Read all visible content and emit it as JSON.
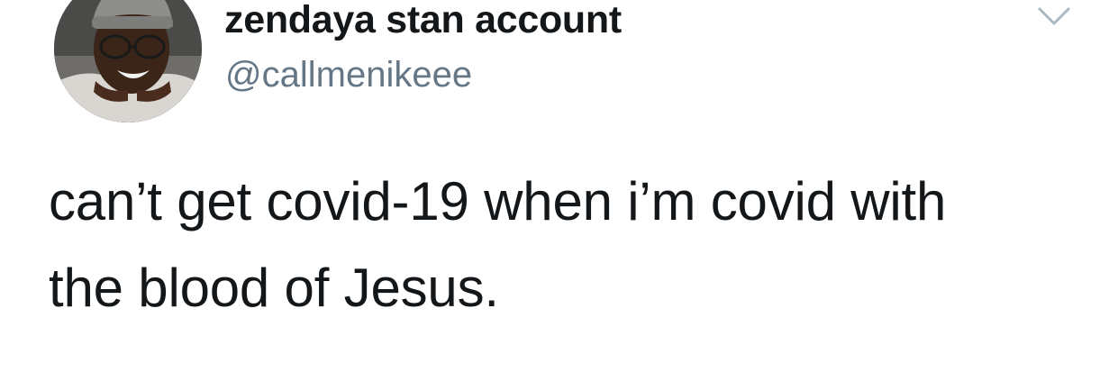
{
  "tweet": {
    "author": {
      "display_name": "zendaya stan account",
      "handle": "@callmenikeee",
      "avatar": "profile-photo"
    },
    "menu_icon": "chevron-down-icon",
    "text": "can’t get covid-19 when i’m covid with\nthe blood of Jesus."
  },
  "colors": {
    "name": "#14171a",
    "handle": "#657786",
    "chevron": "#aab8c2",
    "background": "#ffffff"
  }
}
